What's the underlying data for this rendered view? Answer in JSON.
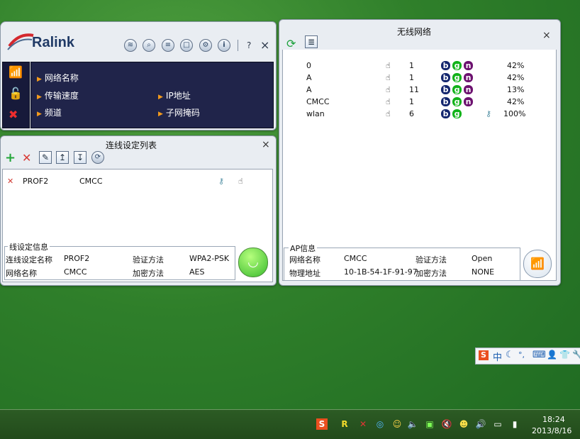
{
  "left_panel": {
    "brand": "Ralink",
    "header_buttons": [
      "rss-icon",
      "search-icon",
      "list-icon",
      "page-icon",
      "gear-icon",
      "info-icon"
    ],
    "help_label": "?",
    "close_label": "×",
    "info": {
      "network_name": "网络名称",
      "transfer_speed": "传输速度",
      "channel": "频道",
      "ip_address": "IP地址",
      "subnet_mask": "子网掩码"
    }
  },
  "profile_panel": {
    "title": "连线设定列表",
    "close_label": "×",
    "toolbar": [
      "add-icon",
      "delete-icon",
      "edit-icon",
      "import-icon",
      "export-icon",
      "connect-icon"
    ],
    "profiles": [
      {
        "name": "PROF2",
        "ssid": "CMCC"
      }
    ],
    "connection_info": {
      "legend": "线设定信息",
      "profile_name_label": "连线设定名称",
      "profile_name_value": "PROF2",
      "network_name_label": "网络名称",
      "network_name_value": "CMCC",
      "auth_label": "验证方法",
      "auth_value": "WPA2-PSK",
      "enc_label": "加密方法",
      "enc_value": "AES"
    }
  },
  "wireless_panel": {
    "title": "无线网络",
    "close_label": "×",
    "networks": [
      {
        "ssid": "0",
        "channel": "1",
        "modes": [
          "b",
          "g",
          "n"
        ],
        "secure": false,
        "signal": "42%"
      },
      {
        "ssid": "A",
        "channel": "1",
        "modes": [
          "b",
          "g",
          "n"
        ],
        "secure": false,
        "signal": "42%"
      },
      {
        "ssid": "A",
        "channel": "11",
        "modes": [
          "b",
          "g",
          "n"
        ],
        "secure": false,
        "signal": "13%"
      },
      {
        "ssid": "CMCC",
        "channel": "1",
        "modes": [
          "b",
          "g",
          "n"
        ],
        "secure": false,
        "signal": "42%"
      },
      {
        "ssid": "wlan",
        "channel": "6",
        "modes": [
          "b",
          "g"
        ],
        "secure": true,
        "signal": "100%"
      }
    ],
    "ap_info": {
      "legend": "AP信息",
      "network_name_label": "网络名称",
      "network_name_value": "CMCC",
      "mac_label": "物理地址",
      "mac_value": "10-1B-54-1F-91-97",
      "auth_label": "验证方法",
      "auth_value": "Open",
      "enc_label": "加密方法",
      "enc_value": "NONE"
    }
  },
  "ime_bar": {
    "items": [
      "S",
      "中",
      "☾",
      "°,",
      "⌨",
      "👤",
      "👕",
      "🔧"
    ]
  },
  "taskbar": {
    "time": "18:24",
    "date": "2013/8/16"
  },
  "colors": {
    "desktop": "#2f7f2a",
    "info_bar": "#20244a",
    "mode_b": "#13266e",
    "mode_g": "#11b219",
    "mode_n": "#6c116f"
  }
}
